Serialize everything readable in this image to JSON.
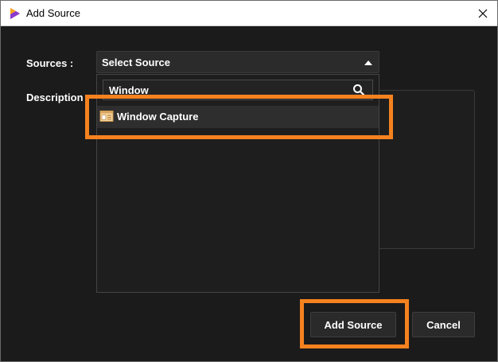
{
  "window": {
    "title": "Add Source",
    "close_glyph": "✕"
  },
  "form": {
    "sources_label": "Sources :",
    "description_label": "Description :"
  },
  "source_select": {
    "selected_text": "Select Source",
    "search_value": "Window",
    "options": [
      {
        "label": "Window Capture",
        "icon": "window-capture-icon"
      }
    ]
  },
  "buttons": {
    "add_source": "Add Source",
    "cancel": "Cancel"
  },
  "colors": {
    "highlight": "#f5821f",
    "background": "#1b1b1b"
  }
}
